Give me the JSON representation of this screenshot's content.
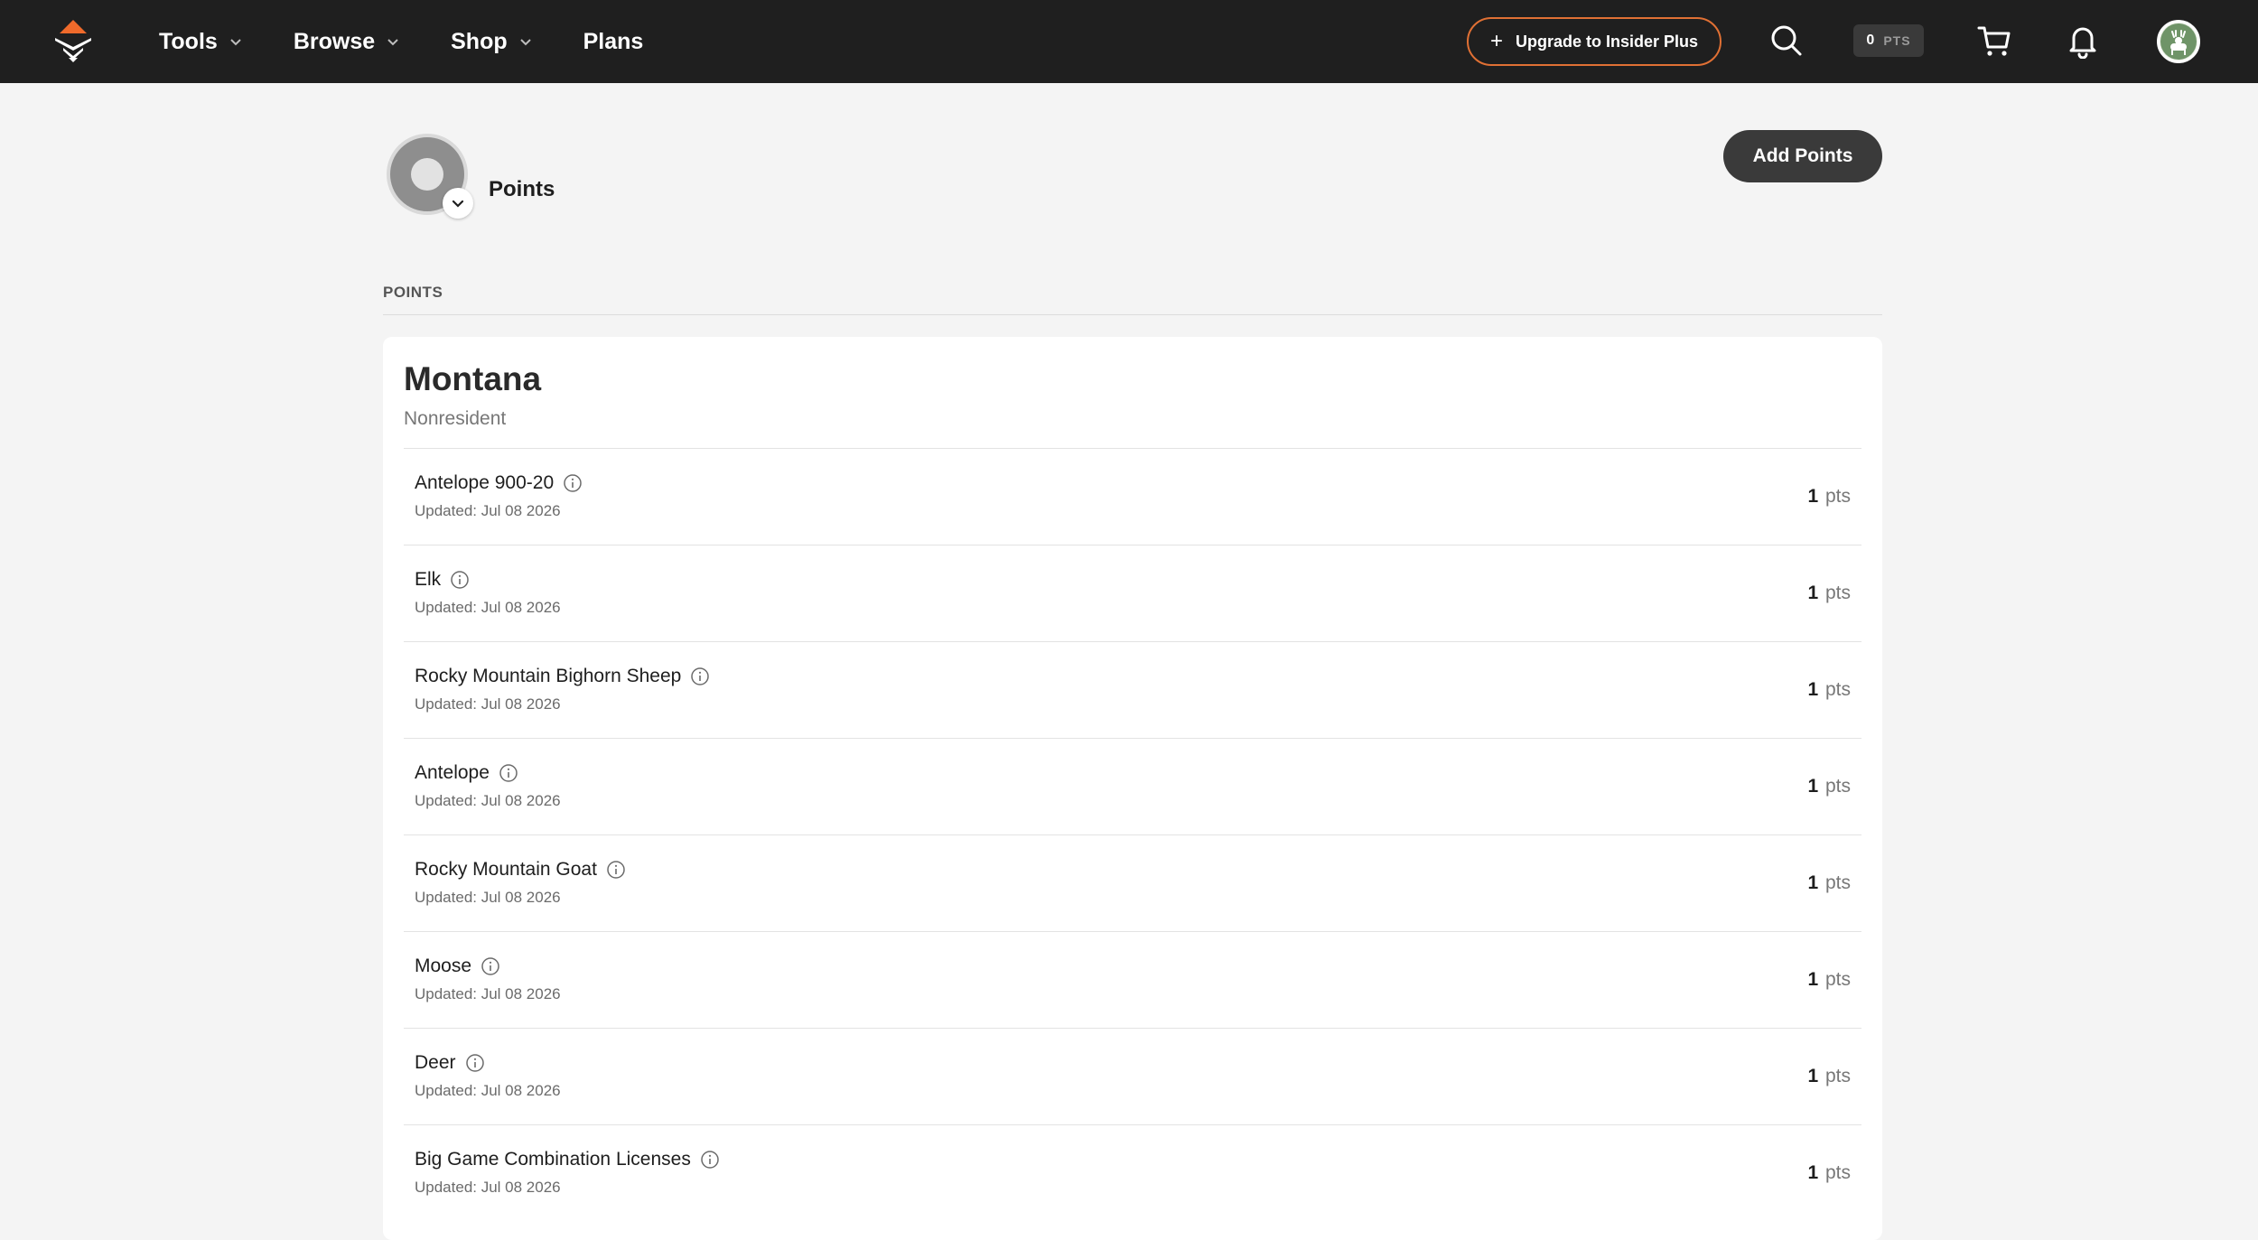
{
  "nav": {
    "links": [
      {
        "label": "Tools",
        "has_menu": true
      },
      {
        "label": "Browse",
        "has_menu": true
      },
      {
        "label": "Shop",
        "has_menu": true
      },
      {
        "label": "Plans",
        "has_menu": false
      }
    ],
    "upgrade_label": "Upgrade to Insider Plus",
    "points_count": "0",
    "points_unit": "PTS",
    "accent_color": "#e07034",
    "bg_color": "#1f1f1f",
    "icons": [
      "search-icon",
      "cart-icon",
      "bell-icon",
      "avatar"
    ]
  },
  "header": {
    "title": "Points",
    "add_points_label": "Add Points"
  },
  "section": {
    "label": "POINTS"
  },
  "state": {
    "name": "Montana",
    "residency": "Nonresident",
    "rows": [
      {
        "species": "Antelope 900-20",
        "updated": "Updated: Jul 08 2026",
        "points": "1",
        "unit": "pts"
      },
      {
        "species": "Elk",
        "updated": "Updated: Jul 08 2026",
        "points": "1",
        "unit": "pts"
      },
      {
        "species": "Rocky Mountain Bighorn Sheep",
        "updated": "Updated: Jul 08 2026",
        "points": "1",
        "unit": "pts"
      },
      {
        "species": "Antelope",
        "updated": "Updated: Jul 08 2026",
        "points": "1",
        "unit": "pts"
      },
      {
        "species": "Rocky Mountain Goat",
        "updated": "Updated: Jul 08 2026",
        "points": "1",
        "unit": "pts"
      },
      {
        "species": "Moose",
        "updated": "Updated: Jul 08 2026",
        "points": "1",
        "unit": "pts"
      },
      {
        "species": "Deer",
        "updated": "Updated: Jul 08 2026",
        "points": "1",
        "unit": "pts"
      },
      {
        "species": "Big Game Combination Licenses",
        "updated": "Updated: Jul 08 2026",
        "points": "1",
        "unit": "pts"
      }
    ]
  }
}
